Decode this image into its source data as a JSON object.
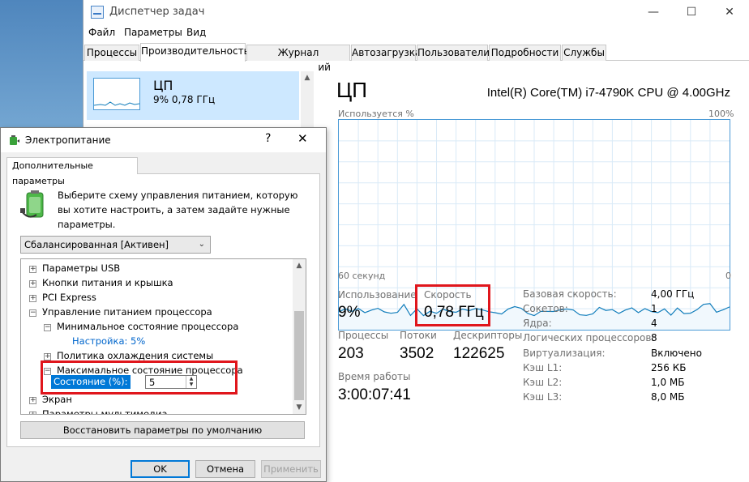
{
  "task_manager": {
    "title": "Диспетчер задач",
    "controls": {
      "minimize": "—",
      "maximize": "☐",
      "close": "✕"
    },
    "menu": [
      "Файл",
      "Параметры",
      "Вид"
    ],
    "tabs": [
      "Процессы",
      "Производительность",
      "Журнал приложений",
      "Автозагрузка",
      "Пользователи",
      "Подробности",
      "Службы"
    ],
    "active_tab": "Производительность",
    "sidebar": {
      "cpu_card": {
        "title": "ЦП",
        "subtitle": "9% 0,78 ГГц"
      }
    },
    "main": {
      "title": "ЦП",
      "model": "Intel(R) Core(TM) i7-4790K CPU @ 4.00GHz",
      "graph": {
        "ylabel": "Используется %",
        "ymax_label": "100%",
        "xlabel_left": "60 секунд",
        "xlabel_right": "0",
        "line_color": "#117dbb",
        "grid_color": "#d9eaf7"
      },
      "stats": {
        "usage_label": "Использование",
        "usage_value": "9%",
        "speed_label": "Скорость",
        "speed_value": "0,78 ГГц",
        "processes_label": "Процессы",
        "processes_value": "203",
        "threads_label": "Потоки",
        "threads_value": "3502",
        "handles_label": "Дескрипторы",
        "handles_value": "122625",
        "uptime_label": "Время работы",
        "uptime_value": "3:00:07:41"
      },
      "details": [
        {
          "label": "Базовая скорость:",
          "value": "4,00 ГГц"
        },
        {
          "label": "Сокетов:",
          "value": "1"
        },
        {
          "label": "Ядра:",
          "value": "4"
        },
        {
          "label": "Логических процессоров:",
          "value": "8"
        },
        {
          "label": "Виртуализация:",
          "value": "Включено"
        },
        {
          "label": "Кэш L1:",
          "value": "256 КБ"
        },
        {
          "label": "Кэш L2:",
          "value": "1,0 МБ"
        },
        {
          "label": "Кэш L3:",
          "value": "8,0 МБ"
        }
      ]
    }
  },
  "power_options": {
    "title": "Электропитание",
    "help": "?",
    "close": "✕",
    "tab": "Дополнительные параметры",
    "description": "Выберите схему управления питанием, которую вы хотите настроить, а затем задайте нужные параметры.",
    "plan": "Сбалансированная [Активен]",
    "tree": [
      {
        "label": "Параметры USB",
        "sign": "+"
      },
      {
        "label": "Кнопки питания и крышка",
        "sign": "+"
      },
      {
        "label": "PCI Express",
        "sign": "+"
      },
      {
        "label": "Управление питанием процессора",
        "sign": "−"
      },
      {
        "label": "Минимальное состояние процессора",
        "sign": "−"
      },
      {
        "label": "Настройка: 5%",
        "sign": ""
      },
      {
        "label": "Политика охлаждения системы",
        "sign": "+"
      },
      {
        "label": "Максимальное состояние процессора",
        "sign": "−"
      },
      {
        "label": "Экран",
        "sign": "+"
      },
      {
        "label": "Параметры мультимедиа",
        "sign": "+"
      }
    ],
    "state_label": "Состояние (%):",
    "state_value": "5",
    "restore_button": "Восстановить параметры по умолчанию",
    "ok_button": "OK",
    "cancel_button": "Отмена",
    "apply_button": "Применить",
    "link_color": "#0066cc",
    "highlight_color": "#e0161c"
  }
}
